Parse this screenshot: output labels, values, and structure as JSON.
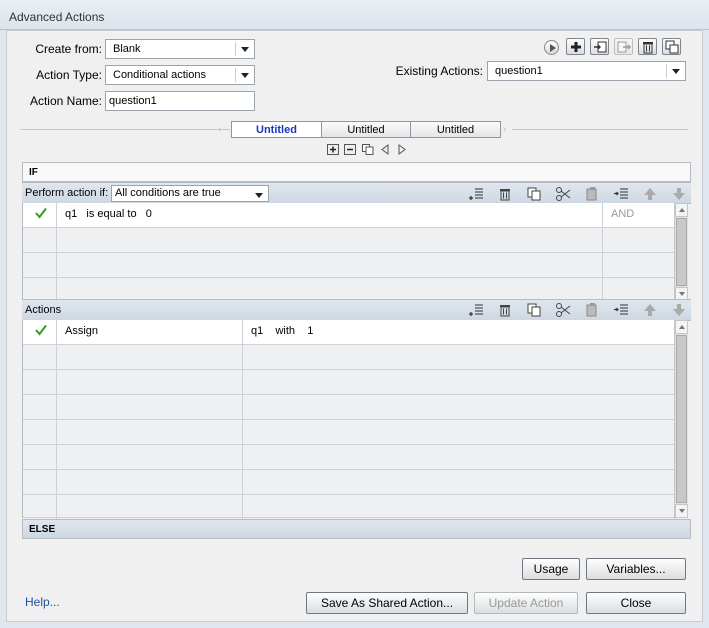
{
  "window": {
    "title": "Advanced Actions"
  },
  "form": {
    "create_from_label": "Create from:",
    "create_from_value": "Blank",
    "action_type_label": "Action Type:",
    "action_type_value": "Conditional actions",
    "action_name_label": "Action Name:",
    "action_name_value": "question1",
    "existing_label": "Existing Actions:",
    "existing_value": "question1"
  },
  "tabs": [
    {
      "label": "Untitled",
      "active": true
    },
    {
      "label": "Untitled",
      "active": false
    },
    {
      "label": "Untitled",
      "active": false
    }
  ],
  "if_section": {
    "header": "IF",
    "perform_label": "Perform action if:",
    "perform_value": "All conditions are true",
    "conditions": [
      {
        "variable": "q1",
        "operator": "is equal to",
        "value": "0",
        "joiner": "AND"
      }
    ]
  },
  "actions_section": {
    "header": "Actions",
    "actions": [
      {
        "command": "Assign",
        "target": "q1",
        "keyword": "with",
        "value": "1"
      }
    ]
  },
  "else_section": {
    "header": "ELSE"
  },
  "buttons": {
    "usage": "Usage",
    "variables": "Variables...",
    "save_shared": "Save As Shared Action...",
    "update": "Update Action",
    "close": "Close"
  },
  "help": "Help..."
}
